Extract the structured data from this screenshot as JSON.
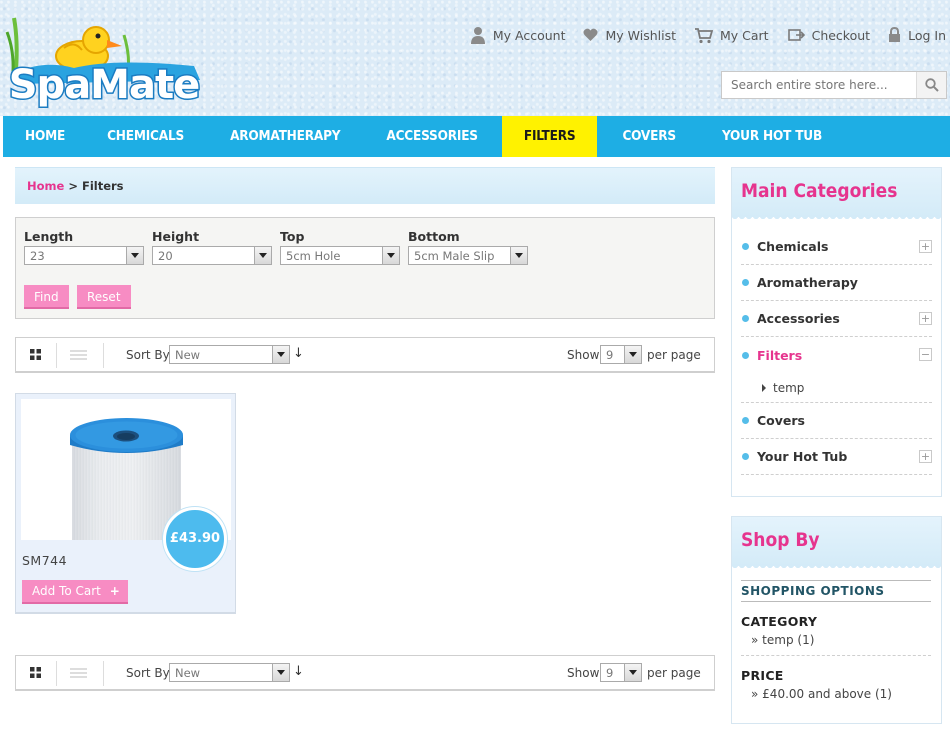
{
  "header": {
    "logo_text": "SpaMate",
    "links": [
      {
        "label": "My Account",
        "icon": "user-icon"
      },
      {
        "label": "My Wishlist",
        "icon": "heart-icon"
      },
      {
        "label": "My Cart",
        "icon": "cart-icon"
      },
      {
        "label": "Checkout",
        "icon": "checkout-icon"
      },
      {
        "label": "Log In",
        "icon": "lock-icon"
      }
    ],
    "search_placeholder": "Search entire store here..."
  },
  "nav": {
    "items": [
      "HOME",
      "CHEMICALS",
      "AROMATHERAPY",
      "ACCESSORIES",
      "FILTERS",
      "COVERS",
      "YOUR HOT TUB"
    ],
    "active": "FILTERS"
  },
  "breadcrumb": {
    "home": "Home",
    "sep": " > ",
    "current": "Filters"
  },
  "filters": {
    "length": {
      "label": "Length",
      "value": "23"
    },
    "height": {
      "label": "Height",
      "value": "20"
    },
    "top": {
      "label": "Top",
      "value": "5cm Hole"
    },
    "bottom": {
      "label": "Bottom",
      "value": "5cm Male Slip"
    },
    "find_label": "Find",
    "reset_label": "Reset"
  },
  "toolbar": {
    "sort_label": "Sort By",
    "sort_value": "New",
    "sort_dir": "↓",
    "show_label": "Show",
    "show_value": "9",
    "per_page": "per page"
  },
  "product": {
    "name": "SM744",
    "price": "£43.90",
    "add_to_cart": "Add To Cart",
    "add_icon": "+"
  },
  "sidebar": {
    "categories_title": "Main Categories",
    "categories": [
      {
        "label": "Chemicals",
        "toggle": "+"
      },
      {
        "label": "Aromatherapy",
        "toggle": ""
      },
      {
        "label": "Accessories",
        "toggle": "+"
      },
      {
        "label": "Filters",
        "toggle": "−"
      },
      {
        "label": "Covers",
        "toggle": ""
      },
      {
        "label": "Your Hot Tub",
        "toggle": "+"
      }
    ],
    "subcategory": "temp",
    "shop_title": "Shop By",
    "shopping_options": "SHOPPING OPTIONS",
    "category_label": "CATEGORY",
    "category_option": "temp (1)",
    "price_label": "PRICE",
    "price_option": "£40.00 and above (1)",
    "option_prefix": "»"
  },
  "colors": {
    "nav_blue": "#1eaee4",
    "active_yellow": "#fff200",
    "pink": "#e6348e",
    "button_pink": "#f78cc3",
    "price_blue": "#4dbbee"
  }
}
